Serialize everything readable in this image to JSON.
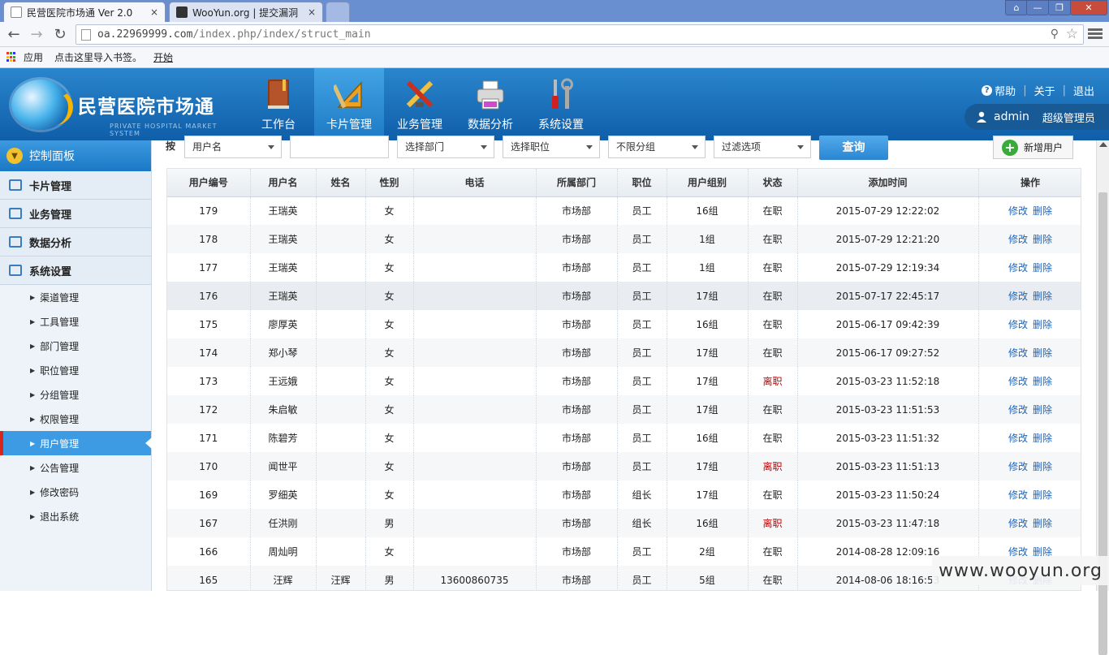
{
  "browser": {
    "tabs": [
      {
        "title": "民营医院市场通 Ver 2.0",
        "close": "×"
      },
      {
        "title": "WooYun.org | 提交漏洞",
        "close": "×"
      }
    ],
    "window_buttons": [
      "⌂",
      "—",
      "❐",
      "✕"
    ],
    "url_host": "oa.22969999.com",
    "url_path": "/index.php/index/struct_main",
    "bookmarks": {
      "apps": "应用",
      "import": "点击这里导入书签。",
      "start": "开始"
    }
  },
  "app": {
    "title": "民营医院市场通",
    "subtitle": "PRIVATE HOSPITAL MARKET SYSTEM",
    "nav": [
      {
        "label": "工作台",
        "icon": "book-icon"
      },
      {
        "label": "卡片管理",
        "icon": "ruler-triangle-icon"
      },
      {
        "label": "业务管理",
        "icon": "tools-cross-icon"
      },
      {
        "label": "数据分析",
        "icon": "printer-icon"
      },
      {
        "label": "系统设置",
        "icon": "screwdriver-wrench-icon"
      }
    ],
    "active_nav": "卡片管理",
    "top_links": {
      "help": "帮助",
      "about": "关于",
      "logout": "退出"
    },
    "user": {
      "name": "admin",
      "role": "超级管理员"
    }
  },
  "sidebar": {
    "panel": "控制面板",
    "sections": [
      {
        "label": "卡片管理"
      },
      {
        "label": "业务管理"
      },
      {
        "label": "数据分析"
      },
      {
        "label": "系统设置"
      }
    ],
    "items": [
      "渠道管理",
      "工具管理",
      "部门管理",
      "职位管理",
      "分组管理",
      "权限管理",
      "用户管理",
      "公告管理",
      "修改密码",
      "退出系统"
    ],
    "active_item": "用户管理"
  },
  "filters": {
    "label": "按",
    "field_select": "用户名",
    "keyword_value": "",
    "dept_select": "选择部门",
    "position_select": "选择职位",
    "group_select": "不限分组",
    "filter_select": "过滤选项",
    "query_button": "查询",
    "add_button": "新增用户"
  },
  "table": {
    "headers": [
      "用户编号",
      "用户名",
      "姓名",
      "性别",
      "电话",
      "所属部门",
      "职位",
      "用户组别",
      "状态",
      "添加时间",
      "操作"
    ],
    "edit_label": "修改",
    "delete_label": "删除",
    "rows": [
      {
        "id": "179",
        "username": "王瑞英",
        "name": "",
        "gender": "女",
        "phone": "",
        "dept": "市场部",
        "position": "员工",
        "group": "16组",
        "status": "在职",
        "added": "2015-07-29 12:22:02"
      },
      {
        "id": "178",
        "username": "王瑞英",
        "name": "",
        "gender": "女",
        "phone": "",
        "dept": "市场部",
        "position": "员工",
        "group": "1组",
        "status": "在职",
        "added": "2015-07-29 12:21:20"
      },
      {
        "id": "177",
        "username": "王瑞英",
        "name": "",
        "gender": "女",
        "phone": "",
        "dept": "市场部",
        "position": "员工",
        "group": "1组",
        "status": "在职",
        "added": "2015-07-29 12:19:34"
      },
      {
        "id": "176",
        "username": "王瑞英",
        "name": "",
        "gender": "女",
        "phone": "",
        "dept": "市场部",
        "position": "员工",
        "group": "17组",
        "status": "在职",
        "added": "2015-07-17 22:45:17"
      },
      {
        "id": "175",
        "username": "廖厚英",
        "name": "",
        "gender": "女",
        "phone": "",
        "dept": "市场部",
        "position": "员工",
        "group": "16组",
        "status": "在职",
        "added": "2015-06-17 09:42:39"
      },
      {
        "id": "174",
        "username": "郑小琴",
        "name": "",
        "gender": "女",
        "phone": "",
        "dept": "市场部",
        "position": "员工",
        "group": "17组",
        "status": "在职",
        "added": "2015-06-17 09:27:52"
      },
      {
        "id": "173",
        "username": "王远娥",
        "name": "",
        "gender": "女",
        "phone": "",
        "dept": "市场部",
        "position": "员工",
        "group": "17组",
        "status": "离职",
        "added": "2015-03-23 11:52:18"
      },
      {
        "id": "172",
        "username": "朱启敏",
        "name": "",
        "gender": "女",
        "phone": "",
        "dept": "市场部",
        "position": "员工",
        "group": "17组",
        "status": "在职",
        "added": "2015-03-23 11:51:53"
      },
      {
        "id": "171",
        "username": "陈碧芳",
        "name": "",
        "gender": "女",
        "phone": "",
        "dept": "市场部",
        "position": "员工",
        "group": "16组",
        "status": "在职",
        "added": "2015-03-23 11:51:32"
      },
      {
        "id": "170",
        "username": "闻世平",
        "name": "",
        "gender": "女",
        "phone": "",
        "dept": "市场部",
        "position": "员工",
        "group": "17组",
        "status": "离职",
        "added": "2015-03-23 11:51:13"
      },
      {
        "id": "169",
        "username": "罗细英",
        "name": "",
        "gender": "女",
        "phone": "",
        "dept": "市场部",
        "position": "组长",
        "group": "17组",
        "status": "在职",
        "added": "2015-03-23 11:50:24"
      },
      {
        "id": "167",
        "username": "任洪刚",
        "name": "",
        "gender": "男",
        "phone": "",
        "dept": "市场部",
        "position": "组长",
        "group": "16组",
        "status": "离职",
        "added": "2015-03-23 11:47:18"
      },
      {
        "id": "166",
        "username": "周灿明",
        "name": "",
        "gender": "女",
        "phone": "",
        "dept": "市场部",
        "position": "员工",
        "group": "2组",
        "status": "在职",
        "added": "2014-08-28 12:09:16"
      },
      {
        "id": "165",
        "username": "汪辉",
        "name": "汪辉",
        "gender": "男",
        "phone": "13600860735",
        "dept": "市场部",
        "position": "员工",
        "group": "5组",
        "status": "在职",
        "added": "2014-08-06 18:16:53"
      }
    ],
    "highlighted_row": "176"
  },
  "watermark": "www.wooyun.org",
  "colors": {
    "header_blue": "#1f78c4",
    "status_left": "#c00000",
    "link_blue": "#1f64b5",
    "sidebar_active": "#3d9be3"
  }
}
